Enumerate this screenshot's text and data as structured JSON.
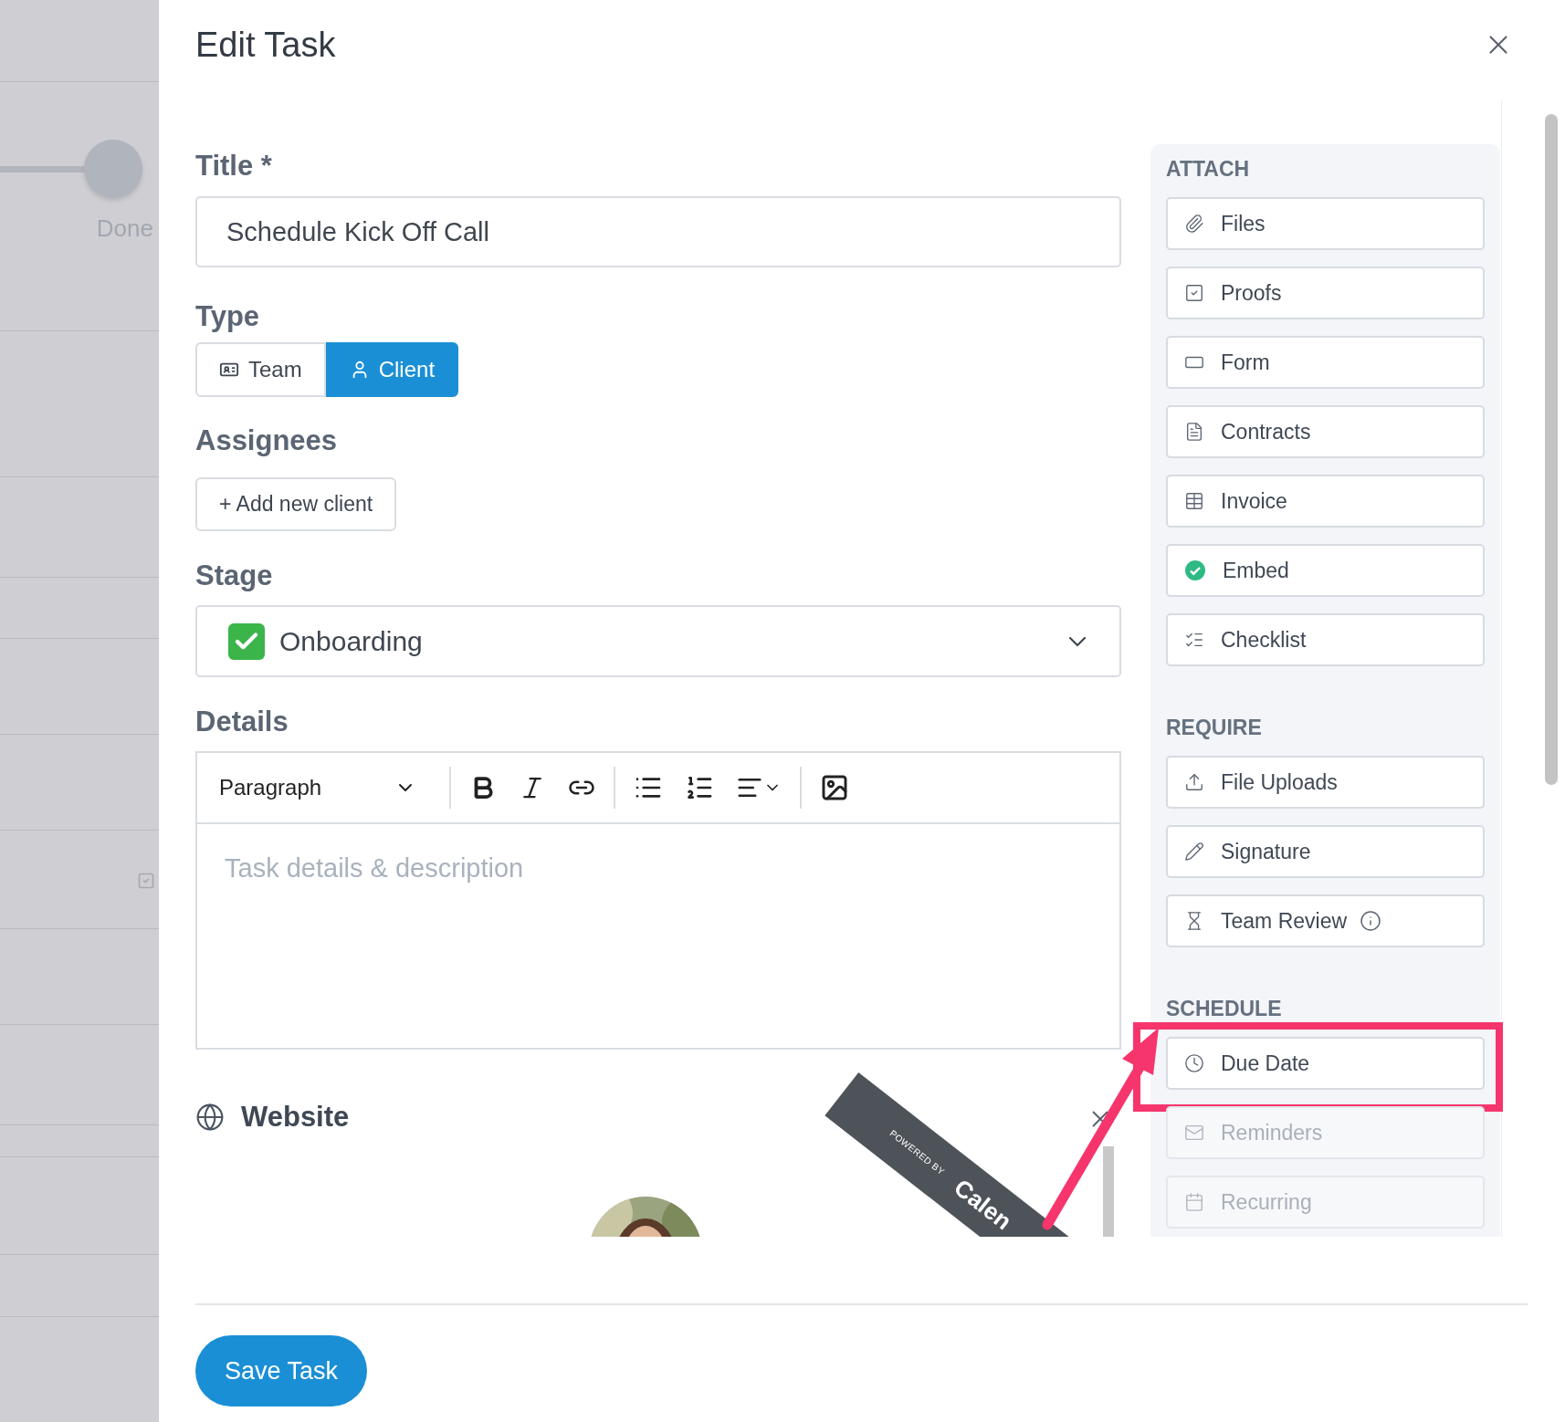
{
  "background": {
    "step_label": "Done"
  },
  "dialog": {
    "title": "Edit Task"
  },
  "form": {
    "title": {
      "label": "Title *",
      "value": "Schedule Kick Off Call"
    },
    "type": {
      "label": "Type",
      "options": [
        {
          "label": "Team",
          "selected": false
        },
        {
          "label": "Client",
          "selected": true
        }
      ]
    },
    "assignees": {
      "label": "Assignees",
      "button": "+ Add new client"
    },
    "stage": {
      "label": "Stage",
      "value": "Onboarding"
    },
    "details": {
      "label": "Details",
      "format": "Paragraph",
      "placeholder": "Task details & description"
    },
    "website": {
      "label": "Website",
      "ribbon_top": "POWERED BY",
      "ribbon_main": "Calen"
    }
  },
  "sidebar": {
    "sections": [
      {
        "heading": "ATTACH",
        "items": [
          {
            "label": "Files",
            "attached": false,
            "disabled": false,
            "highlighted": false,
            "info": false
          },
          {
            "label": "Proofs",
            "attached": false,
            "disabled": false,
            "highlighted": false,
            "info": false
          },
          {
            "label": "Form",
            "attached": false,
            "disabled": false,
            "highlighted": false,
            "info": false
          },
          {
            "label": "Contracts",
            "attached": false,
            "disabled": false,
            "highlighted": false,
            "info": false
          },
          {
            "label": "Invoice",
            "attached": false,
            "disabled": false,
            "highlighted": false,
            "info": false
          },
          {
            "label": "Embed",
            "attached": true,
            "disabled": false,
            "highlighted": false,
            "info": false
          },
          {
            "label": "Checklist",
            "attached": false,
            "disabled": false,
            "highlighted": false,
            "info": false
          }
        ]
      },
      {
        "heading": "REQUIRE",
        "items": [
          {
            "label": "File Uploads",
            "attached": false,
            "disabled": false,
            "highlighted": false,
            "info": false
          },
          {
            "label": "Signature",
            "attached": false,
            "disabled": false,
            "highlighted": false,
            "info": false
          },
          {
            "label": "Team Review",
            "attached": false,
            "disabled": false,
            "highlighted": false,
            "info": true
          }
        ]
      },
      {
        "heading": "SCHEDULE",
        "items": [
          {
            "label": "Due Date",
            "attached": false,
            "disabled": false,
            "highlighted": true,
            "info": false
          },
          {
            "label": "Reminders",
            "attached": false,
            "disabled": true,
            "highlighted": false,
            "info": false
          },
          {
            "label": "Recurring",
            "attached": false,
            "disabled": true,
            "highlighted": false,
            "info": false
          }
        ]
      }
    ]
  },
  "footer": {
    "save_button": "Save Task"
  }
}
